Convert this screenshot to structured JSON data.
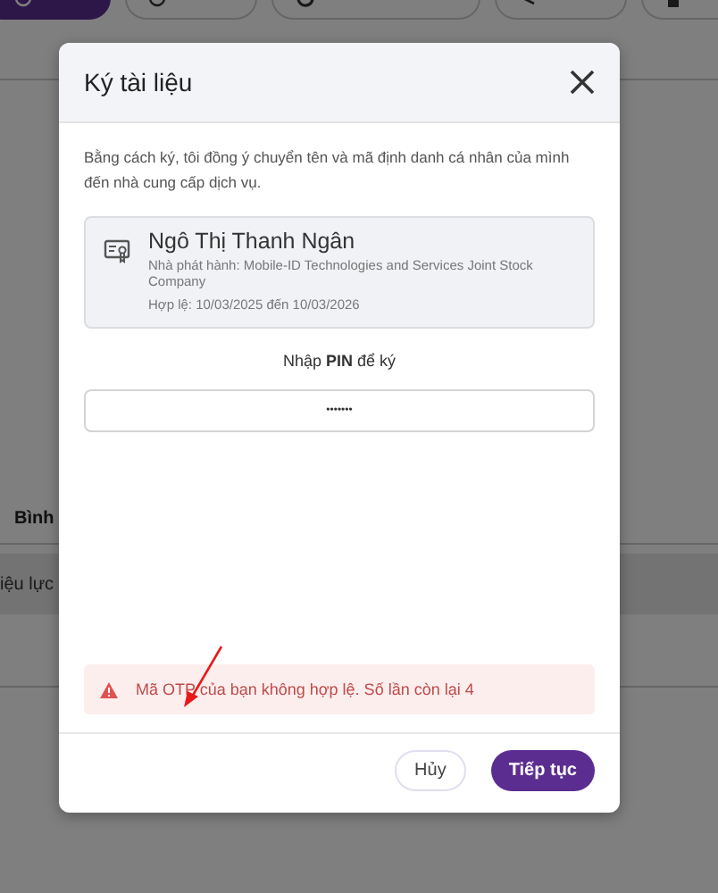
{
  "toolbar": [
    {
      "kind": "primary"
    },
    {
      "kind": "outline"
    },
    {
      "kind": "outline"
    },
    {
      "kind": "outline"
    },
    {
      "kind": "outline"
    }
  ],
  "background_texts": [
    "Bình",
    "iệu lực"
  ],
  "dialog": {
    "title": "Ký tài liệu",
    "consent": "Bằng cách ký, tôi đồng ý chuyển tên và mã định danh cá nhân của mình đến nhà cung cấp dịch vụ.",
    "certificate": {
      "name": "Ngô Thị Thanh Ngân",
      "issuer": "Nhà phát hành: Mobile-ID Technologies and Services Joint Stock Company",
      "validity": "Hợp lệ: 10/03/2025 đến 10/03/2026"
    },
    "pin_prompt": "Nhập **PIN** để ký",
    "pin_field": {
      "value": "•••••••"
    },
    "error": "Mã OTP của bạn không hợp lệ. Số lần còn lại 4",
    "buttons": [
      {
        "label": "Hủy",
        "kind": "secondary"
      },
      {
        "label": "Tiếp tục",
        "kind": "primary"
      }
    ]
  }
}
